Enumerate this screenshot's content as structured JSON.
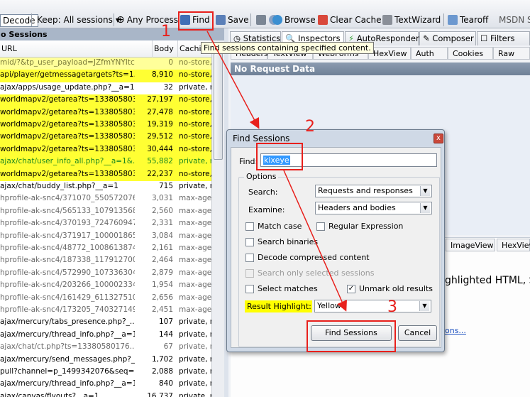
{
  "toolbar": {
    "decode_label": "Decode",
    "keep_label": "Keep: All sessions",
    "any_process_label": "Any Process",
    "find_label": "Find",
    "save_label": "Save",
    "browse_label": "Browse",
    "clear_cache_label": "Clear Cache",
    "textwizard_label": "TextWizard",
    "tearoff_label": "Tearoff",
    "msdn_label": "MSDN Se"
  },
  "sessions": {
    "header": "o Sessions",
    "columns": {
      "url": "URL",
      "body": "Body",
      "caching": "Cachin"
    },
    "rows": [
      {
        "url": "mid/?&tp_user_payload=JZfmYNYItc...",
        "body": "0",
        "cache": "no-store,",
        "style": "yellow-dim"
      },
      {
        "url": "api/player/getmessagetargets?ts=1...",
        "body": "8,910",
        "cache": "no-store,",
        "style": "yellow"
      },
      {
        "url": "ajax/apps/usage_update.php?__a=1",
        "body": "32",
        "cache": "private, n",
        "style": "normal"
      },
      {
        "url": "worldmapv2/getarea?ts=1338058033...",
        "body": "27,197",
        "cache": "no-store,",
        "style": "yellow"
      },
      {
        "url": "worldmapv2/getarea?ts=1338058033...",
        "body": "27,478",
        "cache": "no-store,",
        "style": "yellow"
      },
      {
        "url": "worldmapv2/getarea?ts=1338058033...",
        "body": "19,319",
        "cache": "no-store,",
        "style": "yellow"
      },
      {
        "url": "worldmapv2/getarea?ts=1338058033...",
        "body": "29,512",
        "cache": "no-store,",
        "style": "yellow"
      },
      {
        "url": "worldmapv2/getarea?ts=1338058033...",
        "body": "30,444",
        "cache": "no-store,",
        "style": "yellow"
      },
      {
        "url": "ajax/chat/user_info_all.php?__a=1&...",
        "body": "55,882",
        "cache": "private, n",
        "style": "yellow-green"
      },
      {
        "url": "worldmapv2/getarea?ts=1338058033...",
        "body": "22,237",
        "cache": "no-store,",
        "style": "yellow"
      },
      {
        "url": "ajax/chat/buddy_list.php?__a=1",
        "body": "715",
        "cache": "private, n",
        "style": "normal"
      },
      {
        "url": "hprofile-ak-snc4/371070_550572076...",
        "body": "3,031",
        "cache": "max-age",
        "style": "grey"
      },
      {
        "url": "hprofile-ak-snc4/565133_107913568...",
        "body": "2,560",
        "cache": "max-age",
        "style": "grey"
      },
      {
        "url": "hprofile-ak-snc4/370193_724760947...",
        "body": "2,331",
        "cache": "max-age",
        "style": "grey"
      },
      {
        "url": "hprofile-ak-snc4/371917_100001865...",
        "body": "3,084",
        "cache": "max-age",
        "style": "grey"
      },
      {
        "url": "hprofile-ak-snc4/48772_1008613874...",
        "body": "2,161",
        "cache": "max-age",
        "style": "grey"
      },
      {
        "url": "hprofile-ak-snc4/187338_117912700...",
        "body": "2,464",
        "cache": "max-age",
        "style": "grey"
      },
      {
        "url": "hprofile-ak-snc4/572990_107336304...",
        "body": "2,879",
        "cache": "max-age",
        "style": "grey"
      },
      {
        "url": "hprofile-ak-snc4/203266_100002334...",
        "body": "1,954",
        "cache": "max-age",
        "style": "grey"
      },
      {
        "url": "hprofile-ak-snc4/161429_611327510...",
        "body": "2,656",
        "cache": "max-age",
        "style": "grey"
      },
      {
        "url": "hprofile-ak-snc4/173205_740327149...",
        "body": "2,451",
        "cache": "max-age",
        "style": "grey"
      },
      {
        "url": "ajax/mercury/tabs_presence.php?_...",
        "body": "107",
        "cache": "private, n",
        "style": "normal"
      },
      {
        "url": "ajax/mercury/thread_info.php?__a=1",
        "body": "144",
        "cache": "private, n",
        "style": "normal"
      },
      {
        "url": "ajax/chat/ct.php?ts=13380580176...",
        "body": "67",
        "cache": "private, n",
        "style": "grey"
      },
      {
        "url": "ajax/mercury/send_messages.php?_...",
        "body": "1,702",
        "cache": "private, n",
        "style": "normal"
      },
      {
        "url": "pull?channel=p_1499342076&seq=6...",
        "body": "2,088",
        "cache": "private, n",
        "style": "normal"
      },
      {
        "url": "ajax/mercury/thread_info.php?__a=1",
        "body": "840",
        "cache": "private, n",
        "style": "normal"
      },
      {
        "url": "ajax/canvas/flyouts?__a=1",
        "body": "16,737",
        "cache": "private, n",
        "style": "normal"
      }
    ]
  },
  "right_panel": {
    "tabs": [
      "Statistics",
      "Inspectors",
      "AutoResponder",
      "Composer",
      "Filters"
    ],
    "sub_tabs": [
      "Headers",
      "TextView",
      "WebForms",
      "HexView",
      "Auth",
      "Cookies",
      "Raw"
    ],
    "no_request_data": "No Request Data",
    "response_tabs": [
      "ImageView",
      "HexView"
    ],
    "response_hint": "ghlighted HTML, S",
    "response_link": "ons..."
  },
  "tooltip": "Find sessions containing specified content.",
  "dialog": {
    "title": "Find Sessions",
    "close_symbol": "x",
    "find_label": "Find:",
    "find_value": "kixeye",
    "options_label": "Options",
    "search_label": "Search:",
    "search_value": "Requests and responses",
    "examine_label": "Examine:",
    "examine_value": "Headers and bodies",
    "match_case": "Match case",
    "regex": "Regular Expression",
    "search_binaries": "Search binaries",
    "decode_compressed": "Decode compressed content",
    "search_selected": "Search only selected sessions",
    "select_matches": "Select matches",
    "unmark_old": "Unmark old results",
    "result_highlight_label": "Result Highlight:",
    "result_highlight_value": "Yellow",
    "find_button": "Find Sessions",
    "cancel_button": "Cancel"
  },
  "annotations": {
    "step1": "1",
    "step2": "2",
    "step3": "3"
  },
  "colors": {
    "highlight_yellow": "#ffff33",
    "highlight_dim": "#ffff9a",
    "annotation_red": "#e8201c",
    "green_text": "#1f8a1f"
  }
}
